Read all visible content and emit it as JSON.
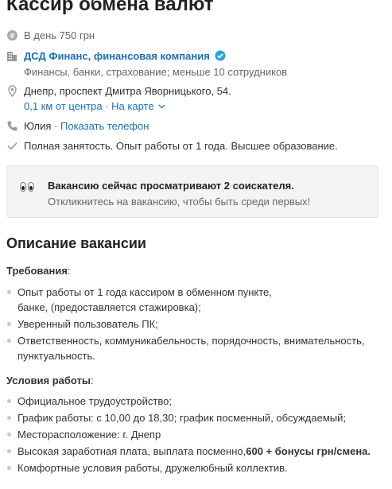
{
  "vacancy": {
    "title": "Кассир обмена валют",
    "salary": "В день 750 грн",
    "company_name": "ДСД Финанс, финансовая компания",
    "company_meta": "Финансы, банки, страхование; меньше 10 сотрудников",
    "address": "Днепр, проспект Дмитра Яворницького, 54.",
    "distance_link": "0,1 км от центра",
    "map_link": "На карте",
    "contact_name": "Юлия",
    "separator": " · ",
    "phone_link": "Показать телефон",
    "conditions_summary": "Полная занятость. Опыт работы от 1 года. Высшее образование."
  },
  "banner": {
    "headline": "Вакансию сейчас просматривают 2 соискателя.",
    "subtext": "Откликнитесь на вакансию, чтобы быть среди первых!"
  },
  "description": {
    "heading": "Описание вакансии",
    "requirements_title": "Требования",
    "requirements": [
      "Опыт работы от 1 года кассиром в обменном пункте, банке, (предоставляется стажировка);",
      "Уверенный пользователь ПК;",
      "Ответственность, коммуникабельность, порядочность, внимательность, пунктуальность."
    ],
    "conditions_title": "Условия работы",
    "conditions": [
      "Официальное трудоустройство;",
      "График работы: с 10,00 до 18,30; график посменный, обсуждаемый;",
      "Месторасположение: г. Днепр"
    ],
    "salary_item_prefix": "Высокая заработная плата, выплата посменно,",
    "salary_item_bold": "600 + бонусы грн/смена.",
    "comfort_item": "Комфортные условия работы, дружелюбный коллектив."
  },
  "colors": {
    "link": "#1a6fb8",
    "verified": "#29a3e0",
    "icon": "#999999"
  }
}
